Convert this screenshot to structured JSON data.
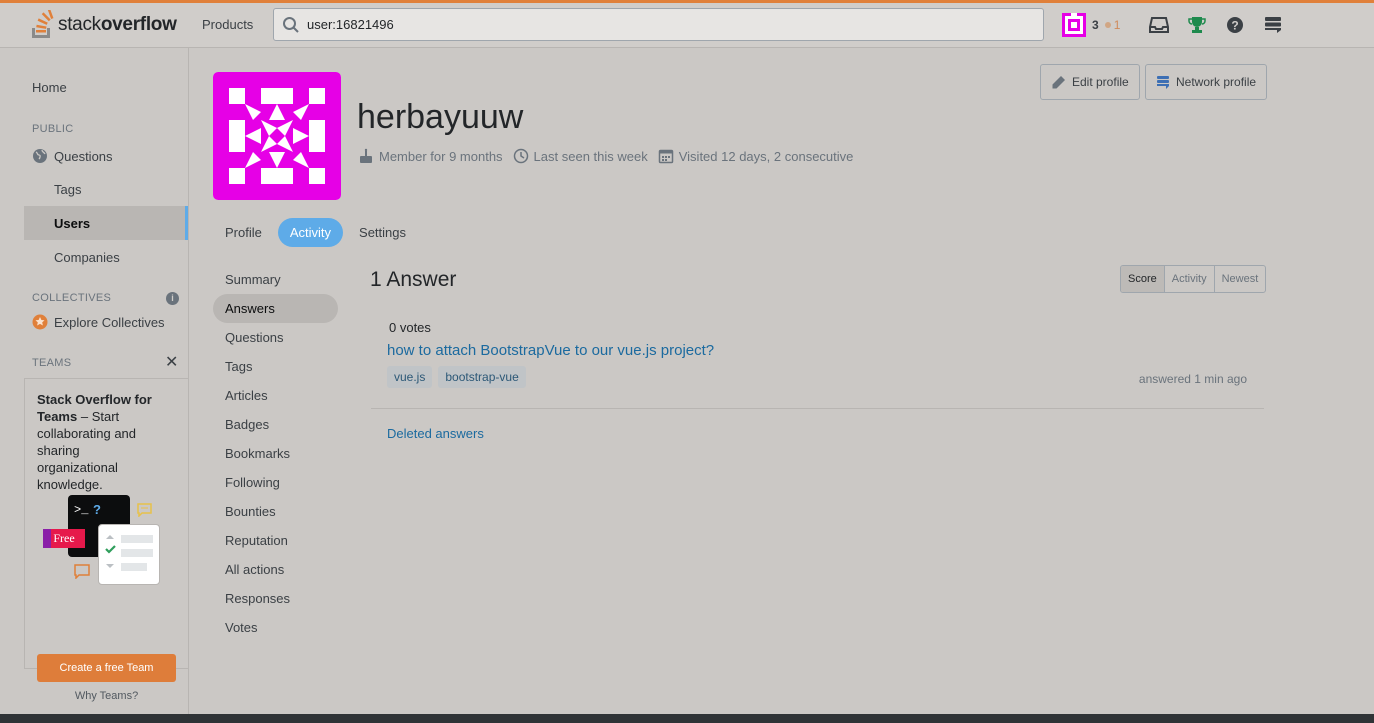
{
  "topbar": {
    "logo_text_plain": "stack",
    "logo_text_bold": "overflow",
    "products_label": "Products",
    "search_value": "user:16821496",
    "reputation": "3",
    "bronze_badges": "1",
    "icons": [
      "inbox-icon",
      "achievements-icon",
      "help-icon",
      "site-switcher-icon"
    ]
  },
  "leftnav": {
    "home": "Home",
    "public_heading": "PUBLIC",
    "questions": "Questions",
    "tags": "Tags",
    "users": "Users",
    "companies": "Companies",
    "collectives_heading": "COLLECTIVES",
    "info": "i",
    "explore_collectives": "Explore Collectives",
    "teams_heading": "TEAMS",
    "close": "✕",
    "teams_title": "Stack Overflow for Teams",
    "teams_desc": " – Start collaborating and sharing organizational knowledge.",
    "free_badge": "Free",
    "prompt": ">_",
    "prompt_q": "?",
    "create_team": "Create a free Team",
    "why_teams": "Why Teams?"
  },
  "profile": {
    "username": "herbayuuw",
    "member_for": "Member for 9 months",
    "last_seen": "Last seen this week",
    "visited": "Visited 12 days, 2 consecutive",
    "edit_profile": "Edit profile",
    "network_profile": "Network profile",
    "avatar_color": "#e600e6"
  },
  "tabs": [
    "Profile",
    "Activity",
    "Settings"
  ],
  "active_tab": "Activity",
  "subnav": [
    "Summary",
    "Answers",
    "Questions",
    "Tags",
    "Articles",
    "Badges",
    "Bookmarks",
    "Following",
    "Bounties",
    "Reputation",
    "All actions",
    "Responses",
    "Votes"
  ],
  "active_subnav": "Answers",
  "answers": {
    "heading": "1 Answer",
    "sort_options": [
      "Score",
      "Activity",
      "Newest"
    ],
    "selected_sort": "Score",
    "items": [
      {
        "votes": "0 votes",
        "title": "how to attach BootstrapVue to our vue.js project?",
        "tags": [
          "vue.js",
          "bootstrap-vue"
        ],
        "answered": "answered 1 min ago"
      }
    ],
    "deleted_link": "Deleted answers"
  },
  "colors": {
    "accent_orange": "#e0803a",
    "link_blue": "#1b6a9f",
    "active_blue": "#5eabe8"
  }
}
